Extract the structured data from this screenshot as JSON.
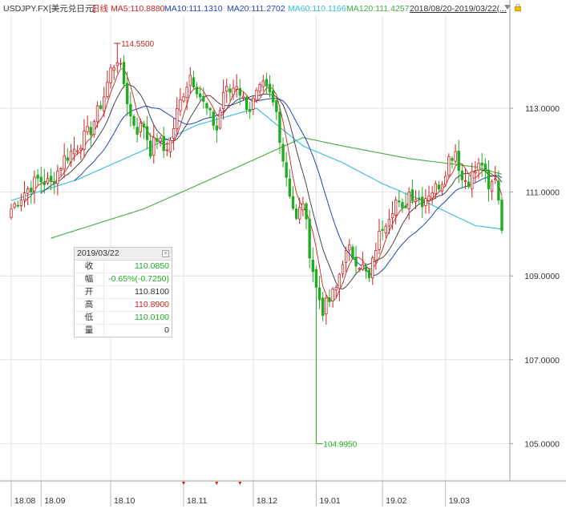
{
  "header": {
    "symbol": "USDJPY.FX",
    "name": "[美元兑日元]",
    "period": "日线",
    "ma5": "MA5:110.8880",
    "ma10": "MA10:111.1310",
    "ma20": "MA20:111.2702",
    "ma60": "MA60:110.1166",
    "ma120": "MA120:111.4257",
    "range": "2018/08/20-2019/03/22(..."
  },
  "colors": {
    "up": "#cc2222",
    "down": "#22aa22",
    "ma5": "#cc2222",
    "ma10": "#333333",
    "ma20": "#2244bb",
    "ma60": "#33bbdd",
    "ma120": "#44aa44",
    "grid": "#e3e3e3"
  },
  "info_box": {
    "date": "2019/03/22",
    "rows": [
      {
        "label": "收",
        "value": "110.0850",
        "color": "#22aa22"
      },
      {
        "label": "幅",
        "value": "-0.65%(-0.7250)",
        "color": "#22aa22"
      },
      {
        "label": "开",
        "value": "110.8100",
        "color": "#333333"
      },
      {
        "label": "高",
        "value": "110.8900",
        "color": "#cc2222"
      },
      {
        "label": "低",
        "value": "110.0100",
        "color": "#22aa22"
      },
      {
        "label": "量",
        "value": "0",
        "color": "#333333"
      }
    ]
  },
  "chart_data": {
    "type": "candlestick",
    "ylim": [
      104.3,
      115.2
    ],
    "y_ticks": [
      "113.0000",
      "111.0000",
      "109.0000",
      "107.0000",
      "105.0000"
    ],
    "x_ticks": [
      {
        "label": "18.08",
        "x": 0
      },
      {
        "label": "18.09",
        "x": 9
      },
      {
        "label": "18.10",
        "x": 30
      },
      {
        "label": "18.11",
        "x": 52
      },
      {
        "label": "18.12",
        "x": 73
      },
      {
        "label": "19.01",
        "x": 92
      },
      {
        "label": "19.02",
        "x": 112
      },
      {
        "label": "19.03",
        "x": 131
      }
    ],
    "annotations": [
      {
        "text": "114.5500",
        "x": 31,
        "y": 114.55
      },
      {
        "text": "104.9950",
        "x": 92,
        "y": 104.995
      }
    ],
    "event_markers_x": [
      52,
      62,
      69
    ],
    "close_keypoints": [
      [
        0,
        110.6
      ],
      [
        4,
        111.0
      ],
      [
        8,
        111.3
      ],
      [
        12,
        111.2
      ],
      [
        16,
        111.8
      ],
      [
        20,
        112.1
      ],
      [
        24,
        112.5
      ],
      [
        28,
        113.3
      ],
      [
        30,
        113.9
      ],
      [
        32,
        114.2
      ],
      [
        34,
        113.6
      ],
      [
        36,
        112.8
      ],
      [
        38,
        112.5
      ],
      [
        40,
        112.6
      ],
      [
        42,
        112.0
      ],
      [
        44,
        112.3
      ],
      [
        46,
        112.0
      ],
      [
        48,
        112.2
      ],
      [
        50,
        112.9
      ],
      [
        52,
        113.4
      ],
      [
        54,
        113.8
      ],
      [
        56,
        113.5
      ],
      [
        58,
        113.1
      ],
      [
        60,
        112.8
      ],
      [
        62,
        112.5
      ],
      [
        64,
        113.4
      ],
      [
        66,
        113.4
      ],
      [
        68,
        113.6
      ],
      [
        70,
        113.2
      ],
      [
        72,
        113.0
      ],
      [
        74,
        113.3
      ],
      [
        76,
        113.5
      ],
      [
        78,
        113.3
      ],
      [
        80,
        112.9
      ],
      [
        82,
        111.8
      ],
      [
        84,
        111.0
      ],
      [
        86,
        110.3
      ],
      [
        88,
        110.8
      ],
      [
        90,
        109.6
      ],
      [
        92,
        108.7
      ],
      [
        94,
        108.2
      ],
      [
        96,
        108.4
      ],
      [
        98,
        108.7
      ],
      [
        100,
        109.4
      ],
      [
        102,
        109.6
      ],
      [
        104,
        109.4
      ],
      [
        106,
        109.2
      ],
      [
        108,
        108.9
      ],
      [
        110,
        109.7
      ],
      [
        112,
        110.2
      ],
      [
        114,
        110.5
      ],
      [
        116,
        110.8
      ],
      [
        118,
        110.5
      ],
      [
        120,
        111.0
      ],
      [
        122,
        110.9
      ],
      [
        124,
        110.8
      ],
      [
        126,
        111.0
      ],
      [
        128,
        111.1
      ],
      [
        130,
        111.3
      ],
      [
        132,
        111.8
      ],
      [
        134,
        112.0
      ],
      [
        136,
        111.3
      ],
      [
        138,
        111.3
      ],
      [
        140,
        111.5
      ],
      [
        142,
        111.7
      ],
      [
        144,
        111.0
      ],
      [
        146,
        111.4
      ],
      [
        147,
        110.81
      ],
      [
        148,
        110.085
      ]
    ],
    "ohlc_last": {
      "open": 110.81,
      "high": 110.89,
      "low": 110.01,
      "close": 110.085
    },
    "overrides": [
      {
        "i": 32,
        "high": 114.55
      },
      {
        "i": 92,
        "low": 104.995
      }
    ],
    "ma120_keypoints": [
      [
        12,
        109.9
      ],
      [
        40,
        110.6
      ],
      [
        60,
        111.3
      ],
      [
        88,
        112.3
      ],
      [
        100,
        112.1
      ],
      [
        120,
        111.8
      ],
      [
        140,
        111.6
      ],
      [
        148,
        111.4257
      ]
    ],
    "ma60_keypoints": [
      [
        0,
        110.8
      ],
      [
        20,
        111.3
      ],
      [
        40,
        112.0
      ],
      [
        56,
        112.6
      ],
      [
        74,
        113.0
      ],
      [
        88,
        112.1
      ],
      [
        100,
        111.7
      ],
      [
        112,
        111.2
      ],
      [
        124,
        110.8
      ],
      [
        140,
        110.2
      ],
      [
        148,
        110.1166
      ]
    ]
  }
}
